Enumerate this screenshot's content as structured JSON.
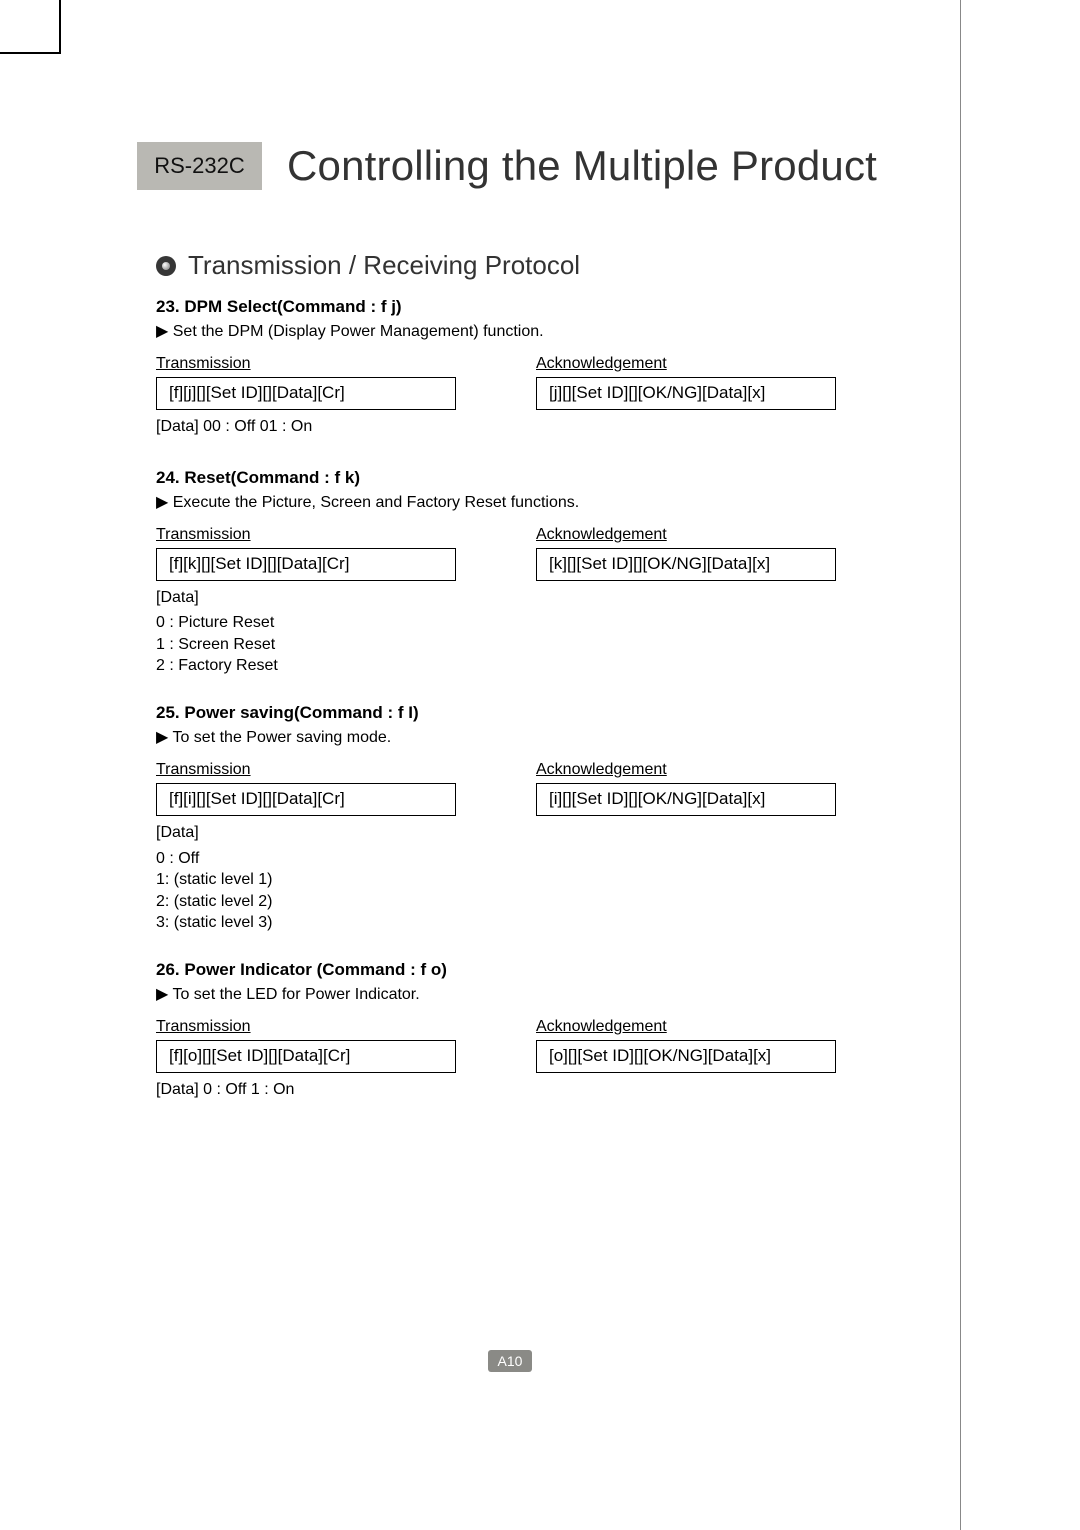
{
  "header": {
    "badge": "RS-232C",
    "title": "Controlling the Multiple Product"
  },
  "section_heading": "Transmission / Receiving Protocol",
  "labels": {
    "transmission": "Transmission",
    "acknowledgement": "Acknowledgement"
  },
  "commands": [
    {
      "title": "23. DPM Select(Command : f j)",
      "desc": "▶ Set the DPM (Display Power Management) function.",
      "tx": "[f][j][][Set ID][][Data][Cr]",
      "ack": "[j][][Set ID][][OK/NG][Data][x]",
      "data_label": "[Data] 00 : Off   01 : On",
      "data_lines": ""
    },
    {
      "title": "24. Reset(Command : f k)",
      "desc": "▶ Execute the Picture, Screen and Factory Reset functions.",
      "tx": "[f][k][][Set ID][][Data][Cr]",
      "ack": "[k][][Set ID][][OK/NG][Data][x]",
      "data_label": "[Data]",
      "data_lines": " 0 : Picture Reset\n 1 : Screen Reset\n 2 : Factory Reset"
    },
    {
      "title": "25. Power saving(Command : f I)",
      "desc": "▶ To set the Power saving mode.",
      "tx": "[f][i][][Set ID][][Data][Cr]",
      "ack": "[i][][Set ID][][OK/NG][Data][x]",
      "data_label": "[Data]",
      "data_lines": " 0 : Off\n 1: (static level 1)\n 2: (static level 2)\n 3: (static level 3)"
    },
    {
      "title": "26. Power Indicator (Command : f o)",
      "desc": "▶ To set the LED for Power Indicator.",
      "tx": "[f][o][][Set ID][][Data][Cr]",
      "ack": "[o][][Set ID][][OK/NG][Data][x]",
      "data_label": "[Data] 0 : Off   1 : On",
      "data_lines": ""
    }
  ],
  "page_number": "A10"
}
